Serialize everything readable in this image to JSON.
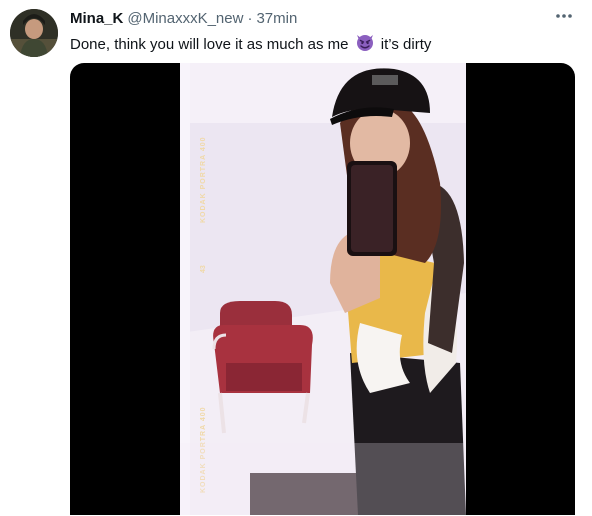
{
  "tweet": {
    "display_name": "Mina_K",
    "handle": "@MinaxxxK_new",
    "separator": "·",
    "time": "37min",
    "text_before_emoji": "Done, think you will love it as much as me",
    "emoji": "smiling-face-with-horns",
    "text_after_emoji": "it’s dirty",
    "more_icon": "more-horizontal-icon"
  },
  "video": {
    "film_label_top": "KODAK PORTRA 400",
    "film_number": "43",
    "film_label_bottom": "KODAK PORTRA 400"
  },
  "colors": {
    "text_primary": "#0f1419",
    "text_secondary": "#536471",
    "emoji_purple": "#8b5fbf",
    "media_bg": "#000000"
  }
}
